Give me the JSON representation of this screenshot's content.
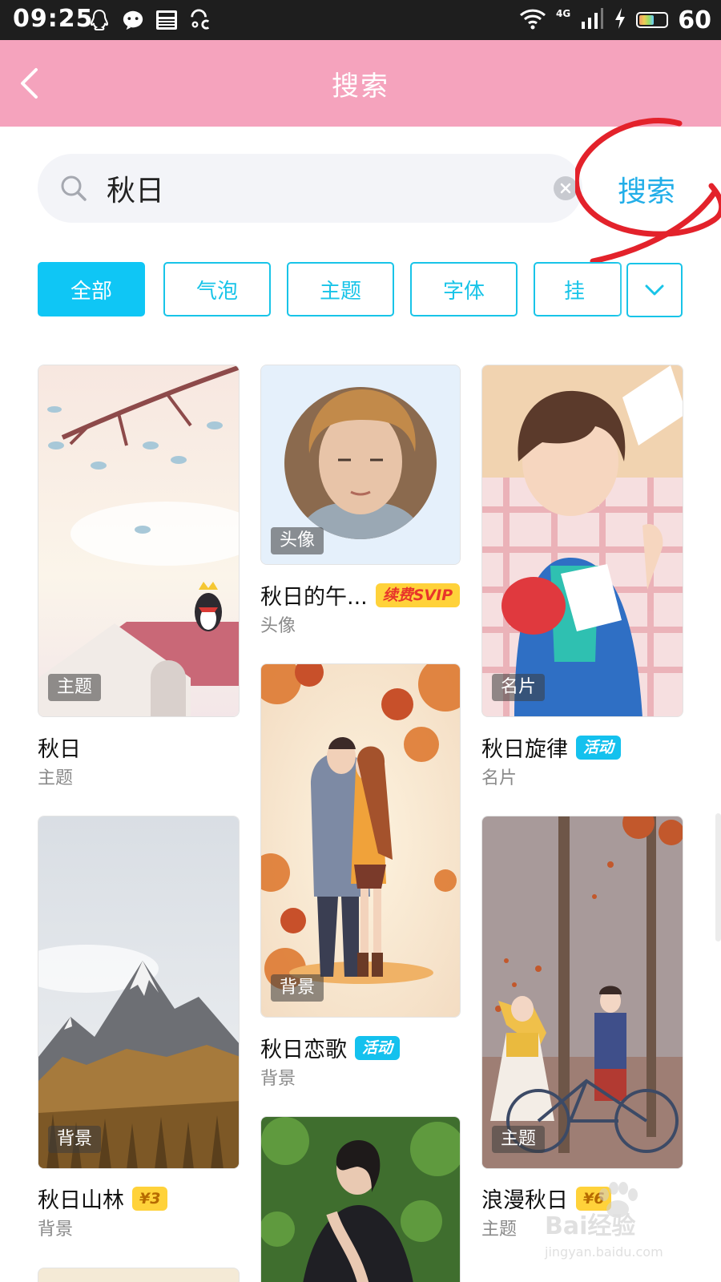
{
  "status_bar": {
    "time": "09:25",
    "network": "4G",
    "battery_level": "60",
    "battery_fraction": 0.6,
    "left_icons": [
      "qq-icon",
      "wechat-icon",
      "news-icon",
      "weather-icon"
    ],
    "right_icons": [
      "wifi-icon",
      "signal-icon",
      "charging-icon",
      "battery-icon"
    ]
  },
  "header": {
    "title": "搜索",
    "background": "#f5a3bd"
  },
  "search": {
    "value": "秋日",
    "button_label": "搜索",
    "accent": "#22aee8"
  },
  "filters": {
    "tabs": [
      {
        "label": "全部",
        "active": true
      },
      {
        "label": "气泡",
        "active": false
      },
      {
        "label": "主题",
        "active": false
      },
      {
        "label": "字体",
        "active": false
      },
      {
        "label": "挂",
        "active": false
      }
    ],
    "active_color": "#0fc6f5"
  },
  "cards": [
    {
      "title": "秋日",
      "category": "主题",
      "tag": "主题",
      "badge": ""
    },
    {
      "title": "秋日的午...",
      "category": "头像",
      "tag": "头像",
      "badge": "续费SVIP"
    },
    {
      "title": "秋日旋律",
      "category": "名片",
      "tag": "名片",
      "badge": "活动"
    },
    {
      "title": "秋日恋歌",
      "category": "背景",
      "tag": "背景",
      "badge": "活动"
    },
    {
      "title": "秋日山林",
      "category": "背景",
      "tag": "背景",
      "badge": "¥3"
    },
    {
      "title": "浪漫秋日",
      "category": "主题",
      "tag": "主题",
      "badge": "¥6"
    }
  ],
  "watermark": {
    "text": "Bai经验",
    "url": "jingyan.baidu.com"
  }
}
